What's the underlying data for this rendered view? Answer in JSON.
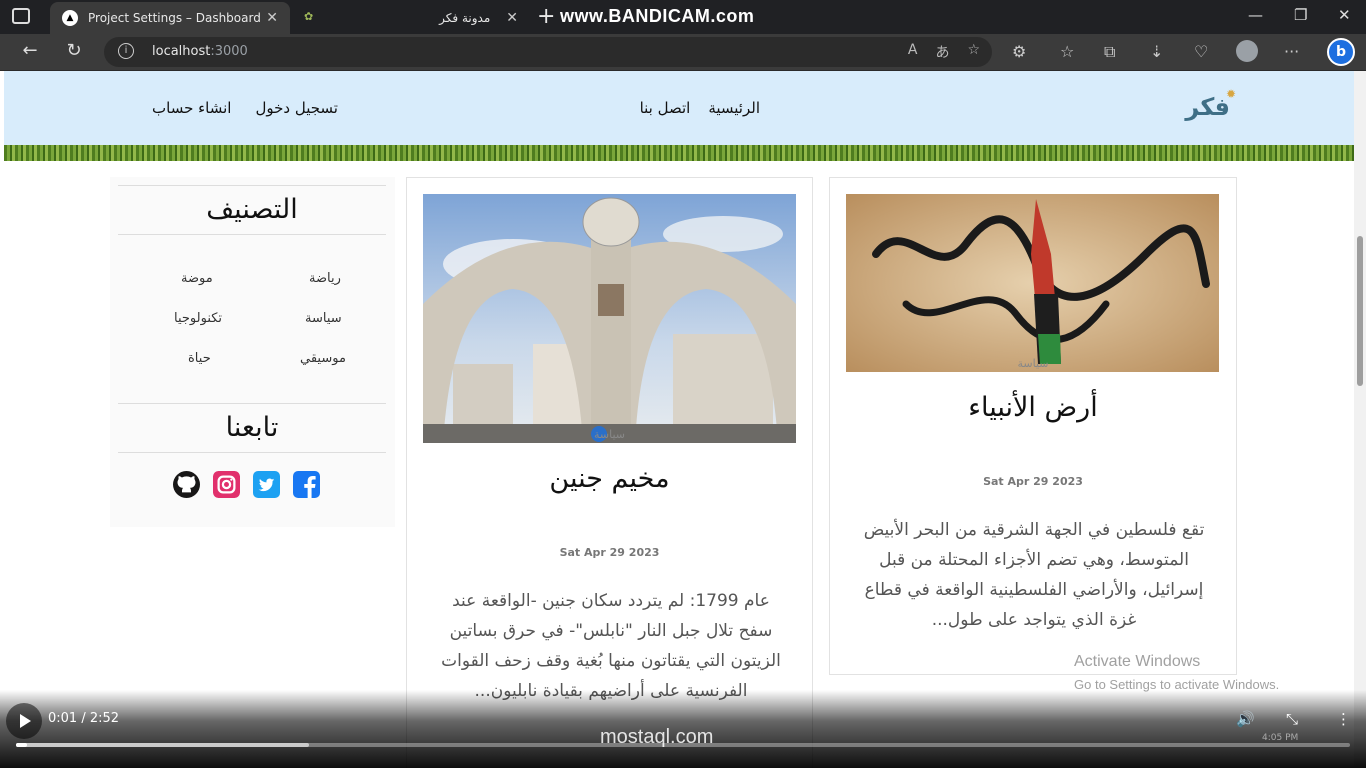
{
  "browser": {
    "tabs": [
      {
        "label": "Project Settings – Dashboard – V",
        "active": true
      },
      {
        "label": "مدونة فكر",
        "active": false
      }
    ],
    "recorder_watermark": "www.BANDICAM.com",
    "url_host": "localhost",
    "url_port": ":3000"
  },
  "site": {
    "logo": "فكر",
    "nav": [
      "الرئيسية",
      "اتصل بنا"
    ],
    "auth": {
      "login": "تسجيل دخول",
      "signup": "انشاء حساب"
    }
  },
  "sidebar": {
    "categories_title": "التصنيف",
    "categories": [
      "رياضة",
      "موضة",
      "سياسة",
      "تكنولوجيا",
      "موسيقي",
      "حياة"
    ],
    "follow_title": "تابعنا",
    "social": [
      "github-icon",
      "instagram-icon",
      "twitter-icon",
      "facebook-icon"
    ]
  },
  "posts": [
    {
      "category": "سياسة",
      "title": "أرض الأنبياء",
      "date": "Sat Apr 29 2023",
      "excerpt": "تقع فلسطين في الجهة الشرقية من البحر الأبيض المتوسط، وهي تضم الأجزاء المحتلة من قبل إسرائيل، والأراضي الفلسطينية الواقعة في قطاع غزة الذي يتواجد على طول..."
    },
    {
      "category": "سياسة",
      "title": "مخيم جنين",
      "date": "Sat Apr 29 2023",
      "excerpt": "عام 1799: لم يتردد سكان جنين -الواقعة عند سفح تلال جبل النار \"نابلس\"- في حرق بساتين الزيتون التي يقتاتون منها بُغية وقف زحف القوات الفرنسية على أراضيهم بقيادة نابليون..."
    }
  ],
  "os_notice": {
    "line1": "Activate Windows",
    "line2": "Go to Settings to activate Windows."
  },
  "video": {
    "time": "0:01 / 2:52",
    "progress_fraction": 0.005,
    "buffered_fraction": 0.22,
    "site_watermark": "mostaql.com",
    "clock": "4:05 PM"
  },
  "colors": {
    "header_bg": "#d8ecfb",
    "facebook": "#1877f2",
    "twitter": "#1da1f2",
    "instagram": "#e1306c",
    "github": "#181717"
  }
}
